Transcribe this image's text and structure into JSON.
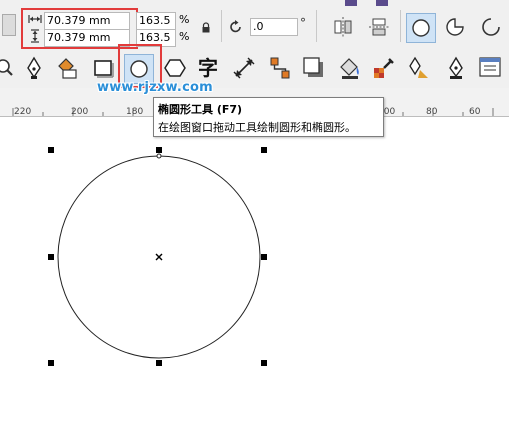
{
  "property_bar": {
    "width_value": "70.379 mm",
    "height_value": "70.379 mm",
    "scale_x": "163.5",
    "scale_y": "163.5",
    "pct_symbol": "%",
    "rotation_value": ".0",
    "degree_symbol": "°"
  },
  "toolbox": {
    "items": [
      "zoom-tool",
      "freehand-tool",
      "smart-fill-tool",
      "rectangle-tool",
      "ellipse-tool",
      "polygon-tool",
      "text-tool",
      "dimension-tool",
      "connector-tool",
      "drop-shadow-tool",
      "fill-tool",
      "eyedropper-tool",
      "interactive-fill-tool",
      "outline-pen-tool",
      "object-properties-tool"
    ],
    "text_tool_glyph": "字"
  },
  "ruler": {
    "labels": [
      "220",
      "200",
      "180",
      "100",
      "80",
      "60"
    ]
  },
  "watermark": "www.rjzxw.com",
  "tooltip": {
    "title": "椭圆形工具 (F7)",
    "description": "在绘图窗口拖动工具绘制圆形和椭圆形。"
  },
  "canvas": {
    "center_marker": "×"
  },
  "colors": {
    "highlight_red": "#e23b3b",
    "watermark_blue": "#2b8fd8",
    "toolbar_bg": "#f0f0f0"
  }
}
